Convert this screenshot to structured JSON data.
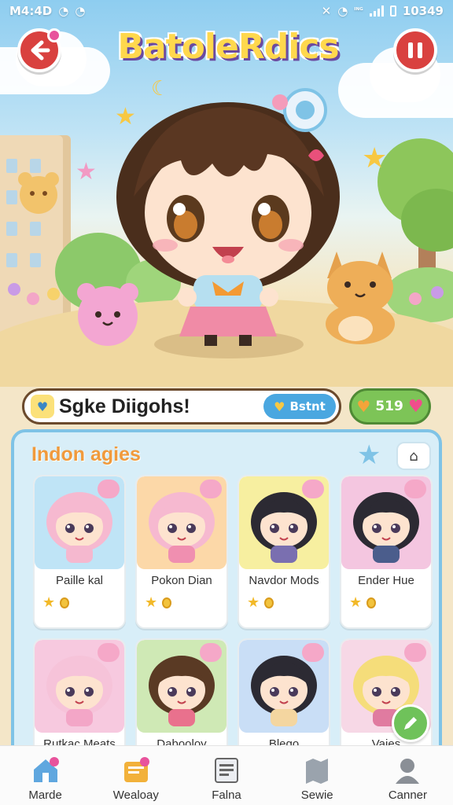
{
  "status_bar": {
    "time": "M4:4D",
    "clock": "10349",
    "net": "ᴵᴺᴳ"
  },
  "game": {
    "title": "BatoleRdics",
    "back_icon": "back-arrow-icon",
    "pause_icon": "pause-icon"
  },
  "message_bar": {
    "text": "Sgke Diigohs!",
    "button_label": "Bstnt",
    "coins": "519"
  },
  "panel": {
    "title": "Indon agies",
    "cards": [
      {
        "name": "Paille kal",
        "bg": "#bfe4f6",
        "hair": "#f6b9d0",
        "outfit": "#f5b8cf"
      },
      {
        "name": "Pokon Dian",
        "bg": "#fcd8a8",
        "hair": "#f6b9d0",
        "outfit": "#f08fb0"
      },
      {
        "name": "Navdor Mods",
        "bg": "#f7efa0",
        "hair": "#2c2a33",
        "outfit": "#7a6fb0"
      },
      {
        "name": "Ender Hue",
        "bg": "#f4c6e0",
        "hair": "#2c2a33",
        "outfit": "#4b5d8c"
      },
      {
        "name": "Rutkac Meats",
        "bg": "#f7c9df",
        "hair": "#f6c3d9",
        "outfit": "#f3a6c7"
      },
      {
        "name": "Dabooloy",
        "bg": "#cfe9b5",
        "hair": "#5a3a24",
        "outfit": "#e9718d"
      },
      {
        "name": "Blego",
        "bg": "#c9def6",
        "hair": "#2c2a33",
        "outfit": "#f4d6a0"
      },
      {
        "name": "Vajes",
        "bg": "#f7d8e6",
        "hair": "#f5dd7a",
        "outfit": "#e07ba0"
      }
    ]
  },
  "nav": [
    {
      "label": "Marde",
      "icon": "home-icon"
    },
    {
      "label": "Wealoay",
      "icon": "mail-icon"
    },
    {
      "label": "Falna",
      "icon": "list-icon"
    },
    {
      "label": "Sewie",
      "icon": "map-icon"
    },
    {
      "label": "Canner",
      "icon": "profile-icon"
    }
  ],
  "colors": {
    "accent_red": "#d9413f",
    "panel_blue": "#7fc3e6",
    "coin_green": "#7dc457",
    "title_orange": "#f09a3c"
  }
}
